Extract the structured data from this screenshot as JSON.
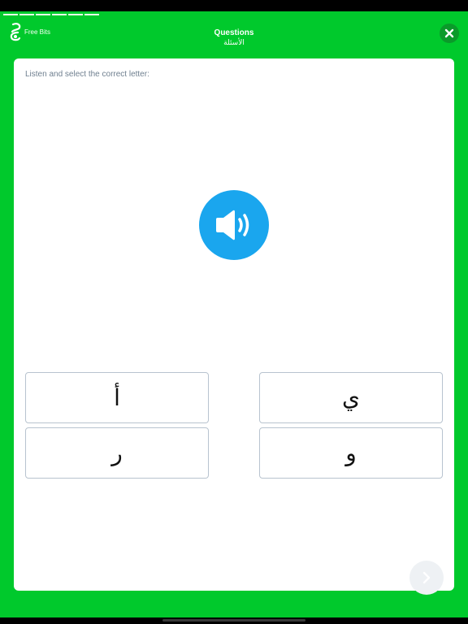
{
  "header": {
    "brand": "Free Bits",
    "title": "Questions",
    "subtitle": "الأسئلة"
  },
  "progress": {
    "segments_total": 6
  },
  "question": {
    "prompt": "Listen and select the correct letter:",
    "audio_icon": "speaker-icon"
  },
  "options": [
    {
      "letter": "أ"
    },
    {
      "letter": "ي"
    },
    {
      "letter": "ر"
    },
    {
      "letter": "و"
    }
  ],
  "icons": {
    "close": "close-icon",
    "next": "chevron-right-icon",
    "logo": "free-bits-logo-icon"
  },
  "colors": {
    "background": "#00c92c",
    "audio_button": "#1aa6ee",
    "card": "#ffffff",
    "option_border": "#b8c3cf"
  }
}
